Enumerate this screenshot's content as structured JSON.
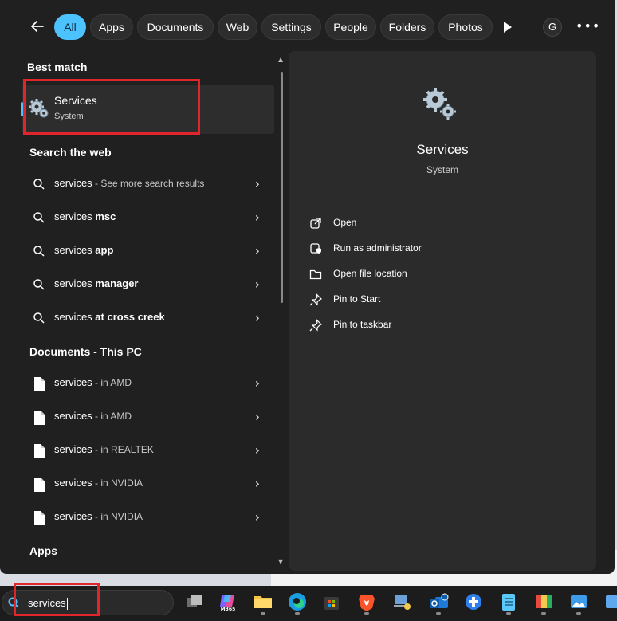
{
  "filters": {
    "back_icon": "arrow-left-icon",
    "chips": [
      {
        "label": "All",
        "active": true
      },
      {
        "label": "Apps"
      },
      {
        "label": "Documents"
      },
      {
        "label": "Web"
      },
      {
        "label": "Settings"
      },
      {
        "label": "People"
      },
      {
        "label": "Folders"
      },
      {
        "label": "Photos"
      }
    ],
    "account_initial": "G",
    "more_label": "•••"
  },
  "left": {
    "best_match_heading": "Best match",
    "best_match": {
      "title": "Services",
      "subtitle": "System"
    },
    "web_heading": "Search the web",
    "web_results": [
      {
        "term": "services",
        "suffix": " - See more search results",
        "bold_suffix": false
      },
      {
        "term": "services",
        "suffix": " msc",
        "bold_suffix": true
      },
      {
        "term": "services",
        "suffix": " app",
        "bold_suffix": true
      },
      {
        "term": "services",
        "suffix": " manager",
        "bold_suffix": true
      },
      {
        "term": "services",
        "suffix": " at cross creek",
        "bold_suffix": true
      }
    ],
    "documents_heading": "Documents - This PC",
    "documents": [
      {
        "term": "services",
        "location": " - in AMD"
      },
      {
        "term": "services",
        "location": " - in AMD"
      },
      {
        "term": "services",
        "location": " - in REALTEK"
      },
      {
        "term": "services",
        "location": " - in NVIDIA"
      },
      {
        "term": "services",
        "location": " - in NVIDIA"
      }
    ],
    "apps_heading": "Apps"
  },
  "detail": {
    "title": "Services",
    "subtitle": "System",
    "actions": [
      {
        "label": "Open",
        "icon": "open-external-icon"
      },
      {
        "label": "Run as administrator",
        "icon": "shield-admin-icon"
      },
      {
        "label": "Open file location",
        "icon": "folder-icon"
      },
      {
        "label": "Pin to Start",
        "icon": "pin-icon"
      },
      {
        "label": "Pin to taskbar",
        "icon": "pin-icon"
      }
    ]
  },
  "taskbar": {
    "search_value": "services",
    "m365_label": "M365"
  },
  "colors": {
    "accent": "#4cc2ff",
    "highlight_box": "#e0262b"
  }
}
